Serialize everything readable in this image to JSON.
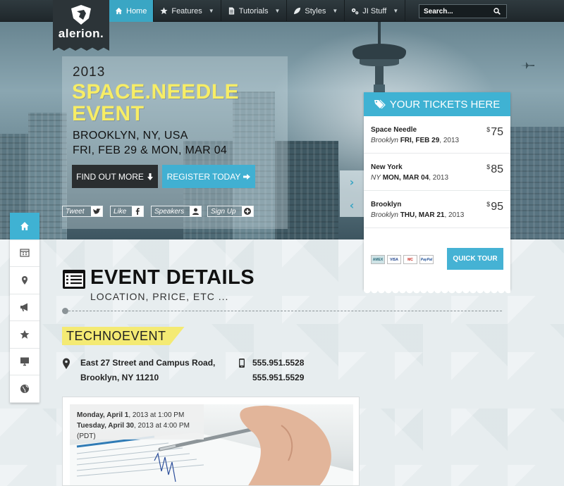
{
  "brand": {
    "logo_text": "alerion."
  },
  "nav": {
    "items": [
      {
        "label": "Home",
        "icon": "home-icon",
        "active": true
      },
      {
        "label": "Features",
        "icon": "star-icon",
        "active": false
      },
      {
        "label": "Tutorials",
        "icon": "document-icon",
        "active": false
      },
      {
        "label": "Styles",
        "icon": "leaf-icon",
        "active": false
      },
      {
        "label": "JI Stuff",
        "icon": "gears-icon",
        "active": false
      }
    ],
    "search_placeholder": "Search..."
  },
  "hero": {
    "year": "2013",
    "title_line1": "SPACE.NEEDLE",
    "title_line2": "EVENT",
    "location": "BROOKLYN, NY, USA",
    "dates": "FRI, FEB 29 & MON, MAR 04",
    "find_out_label": "FIND OUT MORE",
    "register_label": "REGISTER TODAY",
    "social": [
      {
        "label": "Tweet",
        "icon": "twitter-icon"
      },
      {
        "label": "Like",
        "icon": "facebook-icon"
      },
      {
        "label": "Speakers",
        "icon": "user-icon"
      },
      {
        "label": "Sign Up",
        "icon": "plus-circle-icon"
      }
    ]
  },
  "tickets": {
    "header": "YOUR TICKETS HERE",
    "rows": [
      {
        "name": "Space Needle",
        "city": "Brooklyn",
        "date_bold": "FRI, FEB 29",
        "year": ", 2013",
        "currency": "$",
        "price": "75"
      },
      {
        "name": "New York",
        "city": "NY",
        "date_bold": "MON, MAR 04",
        "year": ", 2013",
        "currency": "$",
        "price": "85"
      },
      {
        "name": "Brooklyn",
        "city": "Brooklyn",
        "date_bold": "THU, MAR 21",
        "year": ", 2013",
        "currency": "$",
        "price": "95"
      }
    ],
    "cards": [
      "AMEX",
      "VISA",
      "MC",
      "PayPal"
    ],
    "quick_tour_label": "QUICK TOUR"
  },
  "dock": {
    "items": [
      "home-icon",
      "calendar-icon",
      "map-pin-icon",
      "megaphone-icon",
      "star-icon",
      "monitor-icon",
      "globe-icon"
    ]
  },
  "event_details": {
    "title": "EVENT DETAILS",
    "subtitle": "LOCATION, PRICE, ETC ...",
    "tag": "TECHNOEVENT",
    "address_line1": "East 27 Street and Campus Road,",
    "address_line2": "Brooklyn, NY 11210",
    "phone1": "555.951.5528",
    "phone2": "555.951.5529",
    "date1_day": "Monday, April 1",
    "date1_rest": ", 2013 at 1:00 PM",
    "date2_day": "Tuesday, April 30",
    "date2_rest": ", 2013 at 4:00 PM (PDT)"
  },
  "colors": {
    "accent": "#3fb2d3",
    "highlight_yellow": "#f4ea73",
    "dark_button": "#2a2e30",
    "nav_bg": "#232c30"
  }
}
